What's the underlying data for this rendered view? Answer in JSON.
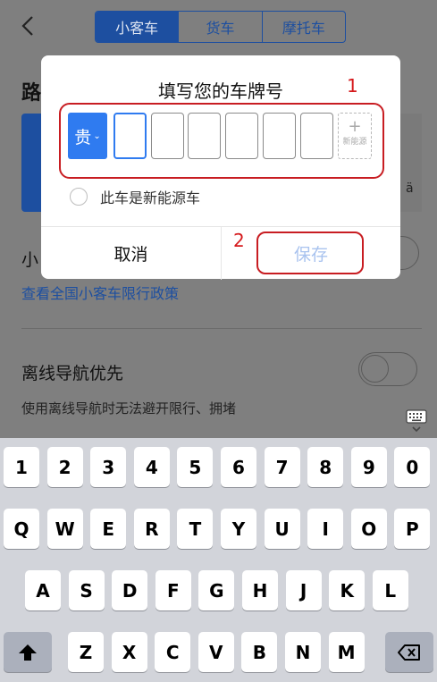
{
  "header": {
    "tabs": [
      {
        "label": "小客车",
        "active": true
      },
      {
        "label": "货车",
        "active": false
      },
      {
        "label": "摩托车",
        "active": false
      }
    ]
  },
  "background": {
    "section_title_partial": "路",
    "card_right_partial": "ä",
    "small_car_label_partial": "小",
    "policy_link": "查看全国小客车限行政策",
    "offline_title": "离线导航优先",
    "offline_desc": "使用离线导航时无法避开限行、拥堵"
  },
  "dialog": {
    "title": "填写您的车牌号",
    "province": "贵",
    "plate_cells": [
      "",
      "",
      "",
      "",
      "",
      ""
    ],
    "new_energy_cell_label": "新能源",
    "new_energy_cell_plus": "+",
    "new_energy_checkbox_label": "此车是新能源车",
    "cancel_label": "取消",
    "save_label": "保存"
  },
  "annotations": {
    "label_1": "1",
    "label_2": "2",
    "color": "#d5191c"
  },
  "keyboard": {
    "row1": [
      "1",
      "2",
      "3",
      "4",
      "5",
      "6",
      "7",
      "8",
      "9",
      "0"
    ],
    "row2": [
      "Q",
      "W",
      "E",
      "R",
      "T",
      "Y",
      "U",
      "I",
      "O",
      "P"
    ],
    "row3": [
      "A",
      "S",
      "D",
      "F",
      "G",
      "H",
      "J",
      "K",
      "L"
    ],
    "row4": [
      "Z",
      "X",
      "C",
      "V",
      "B",
      "N",
      "M"
    ]
  },
  "colors": {
    "accent": "#2f7bf0",
    "overlay_accent": "#1d4fa0",
    "save_disabled": "#a9c3ef"
  }
}
